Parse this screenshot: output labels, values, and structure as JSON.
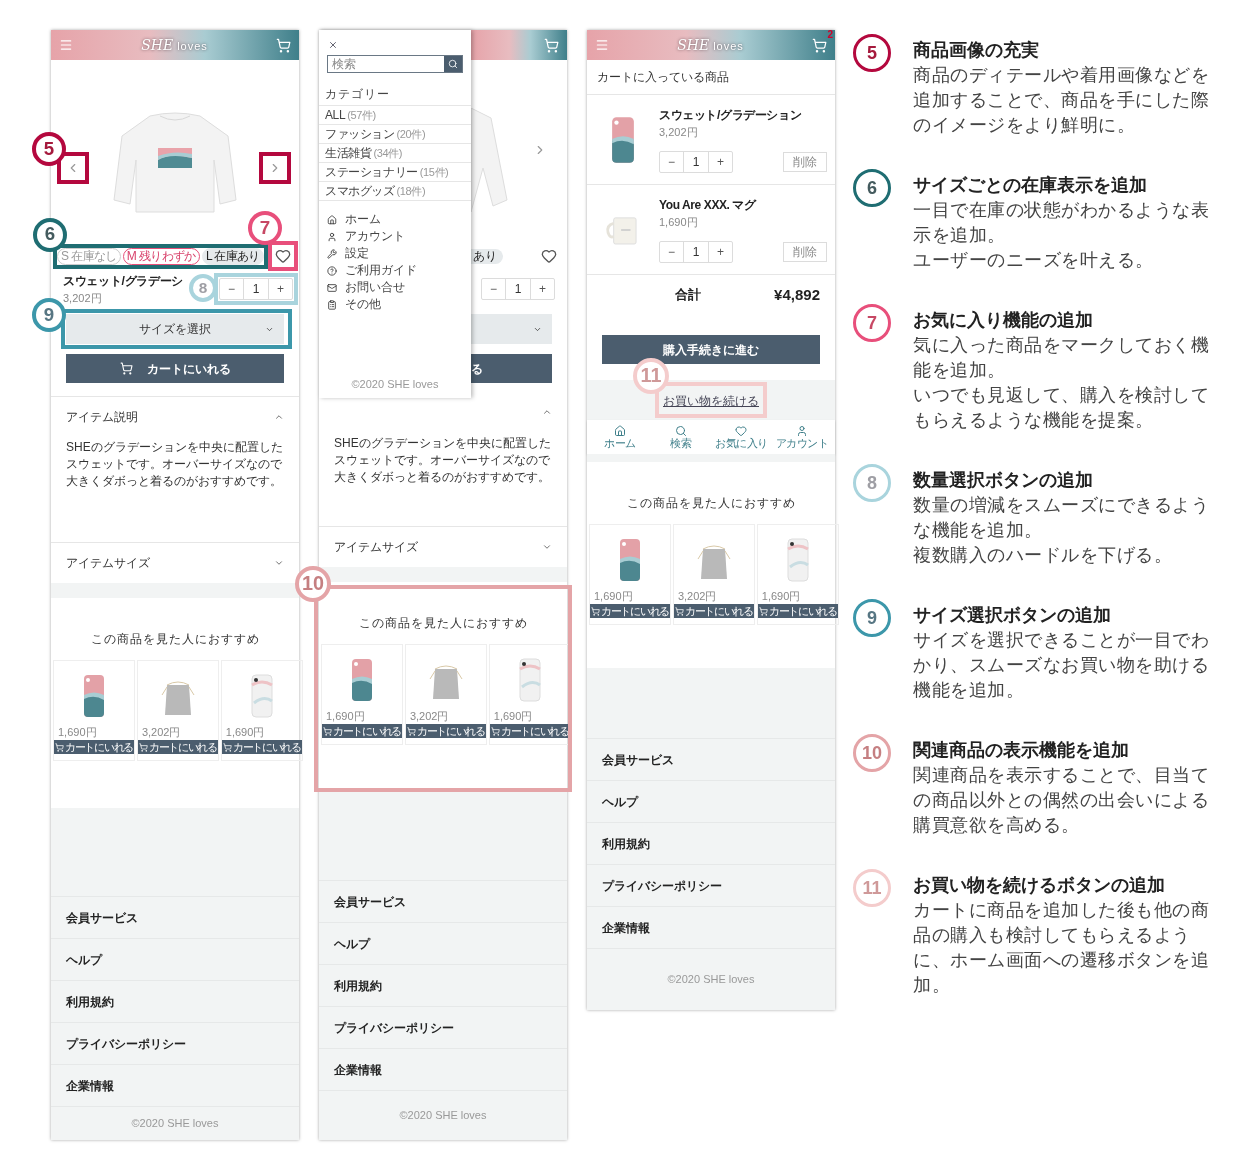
{
  "product_screen": {
    "logo_mark": "SHE",
    "logo_text": "loves",
    "stock": [
      {
        "label": "S 在庫なし",
        "kind": "out"
      },
      {
        "label": "M 残りわずか",
        "kind": "low"
      },
      {
        "label": "L 在庫あり",
        "kind": "in"
      }
    ],
    "title": "スウェット/グラデーシ",
    "price": "3,202円",
    "minus": "−",
    "quantity": "1",
    "plus": "+",
    "size_select": "サイズを選択",
    "cart_button": "カートにいれる",
    "description": {
      "title": "アイテム説明",
      "expanded": true,
      "text": "SHEのグラデーションを中央に配置したスウェットです。オーバーサイズなので大きくダボっと着るのがおすすめです。"
    },
    "size_section": {
      "title": "アイテムサイズ",
      "expanded": false
    },
    "recommend": {
      "title": "この商品を見た人におすすめ",
      "items": [
        {
          "price": "1,690円",
          "button": "カートにいれる"
        },
        {
          "price": "3,202円",
          "button": "カートにいれる"
        },
        {
          "price": "1,690円",
          "button": "カートにいれる"
        }
      ]
    },
    "footer_links": [
      "会員サービス",
      "ヘルプ",
      "利用規約",
      "プライバシーポリシー",
      "企業情報"
    ],
    "copyright": "©2020 SHE loves",
    "callouts": [
      {
        "number": "5",
        "color": "#b4083e"
      },
      {
        "number": "6",
        "color": "#1f6d72"
      },
      {
        "number": "7",
        "color": "#e84f7b"
      },
      {
        "number": "8",
        "color": "#a9d4dd"
      },
      {
        "number": "9",
        "color": "#3c97aa"
      }
    ]
  },
  "menu_screen": {
    "drawer": {
      "search_placeholder": "検索",
      "category_heading": "カテゴリー",
      "categories": [
        {
          "name": "ALL",
          "count": "(57件)"
        },
        {
          "name": "ファッション",
          "count": "(20件)"
        },
        {
          "name": "生活雑貨",
          "count": "(34件)"
        },
        {
          "name": "ステーショナリー",
          "count": "(15件)"
        },
        {
          "name": "スマホグッズ",
          "count": "(18件)"
        }
      ],
      "links": [
        {
          "kind": "home",
          "label": "ホーム"
        },
        {
          "kind": "account",
          "label": "アカウント"
        },
        {
          "kind": "settings",
          "label": "設定"
        },
        {
          "kind": "guide",
          "label": "ご利用ガイド"
        },
        {
          "kind": "contact",
          "label": "お問い合せ"
        },
        {
          "kind": "other",
          "label": "その他"
        }
      ],
      "copyright": "©2020 SHE loves"
    },
    "stock_fragment": "あり",
    "minus": "−",
    "quantity": "1",
    "plus": "+",
    "cart_fragment": "る",
    "description": {
      "expanded": true,
      "text": "SHEのグラデーションを中央に配置したスウェットです。オーバーサイズなので大きくダボっと着るのがおすすめです。"
    },
    "size_section": {
      "title": "アイテムサイズ",
      "expanded": false
    },
    "recommend": {
      "title": "この商品を見た人におすすめ",
      "items": [
        {
          "price": "1,690円",
          "button": "カートにいれる"
        },
        {
          "price": "3,202円",
          "button": "カートにいれる"
        },
        {
          "price": "1,690円",
          "button": "カートにいれる"
        }
      ]
    },
    "footer_links": [
      "会員サービス",
      "ヘルプ",
      "利用規約",
      "プライバシーポリシー",
      "企業情報"
    ],
    "copyright": "©2020 SHE loves",
    "callout": {
      "number": "10",
      "color": "#e4a4a7"
    }
  },
  "cart_screen": {
    "logo_mark": "SHE",
    "logo_text": "loves",
    "cart_count": "2",
    "heading": "カートに入っている商品",
    "items": [
      {
        "name": "スウェット/グラデーション",
        "price": "3,202円",
        "minus": "−",
        "quantity": "1",
        "plus": "+",
        "remove": "削除"
      },
      {
        "name": "You Are XXX. マグ",
        "price": "1,690円",
        "minus": "−",
        "quantity": "1",
        "plus": "+",
        "remove": "削除"
      }
    ],
    "total_label": "合計",
    "total": "¥4,892",
    "checkout": "購入手続きに進む",
    "continue": "お買い物を続ける",
    "nav": [
      {
        "kind": "home",
        "label": "ホーム"
      },
      {
        "kind": "search",
        "label": "検索"
      },
      {
        "kind": "favorite",
        "label": "お気に入り"
      },
      {
        "kind": "account",
        "label": "アカウント"
      }
    ],
    "recommend": {
      "title": "この商品を見た人におすすめ",
      "items": [
        {
          "price": "1,690円",
          "button": "カートにいれる"
        },
        {
          "price": "3,202円",
          "button": "カートにいれる"
        },
        {
          "price": "1,690円",
          "button": "カートにいれる"
        }
      ]
    },
    "footer_links": [
      "会員サービス",
      "ヘルプ",
      "利用規約",
      "プライバシーポリシー",
      "企業情報"
    ],
    "copyright": "©2020 SHE loves",
    "callout": {
      "number": "11",
      "color": "#f4cccc"
    }
  },
  "annotations": [
    {
      "number": "5",
      "color": "#b4083e",
      "title": "商品画像の充実",
      "lines": [
        "商品のディテールや着用画像などを追加することで、商品を手にした際のイメージをより鮮明に。"
      ]
    },
    {
      "number": "6",
      "color": "#1f6d72",
      "title": "サイズごとの在庫表示を追加",
      "lines": [
        "一目で在庫の状態がわかるような表示を追加。",
        "ユーザーのニーズを叶える。"
      ]
    },
    {
      "number": "7",
      "color": "#e84f7b",
      "title": "お気に入り機能の追加",
      "lines": [
        "気に入った商品をマークしておく機能を追加。",
        "いつでも見返して、購入を検討してもらえるような機能を提案。"
      ]
    },
    {
      "number": "8",
      "color": "#a9d4dd",
      "title": "数量選択ボタンの追加",
      "lines": [
        "数量の増減をスムーズにできるような機能を追加。",
        "複数購入のハードルを下げる。"
      ]
    },
    {
      "number": "9",
      "color": "#3c97aa",
      "title": "サイズ選択ボタンの追加",
      "lines": [
        "サイズを選択できることが一目でわかり、スムーズなお買い物を助ける機能を追加。"
      ]
    },
    {
      "number": "10",
      "color": "#e4a4a7",
      "title": "関連商品の表示機能を追加",
      "lines": [
        "関連商品を表示することで、目当ての商品以外との偶然の出会いによる購買意欲を高める。"
      ]
    },
    {
      "number": "11",
      "color": "#f4cccc",
      "title": "お買い物を続けるボタンの追加",
      "lines": [
        "カートに商品を追加した後も他の商品の購入も検討してもらえるように、ホーム画面への遷移ボタンを追加。"
      ]
    }
  ]
}
